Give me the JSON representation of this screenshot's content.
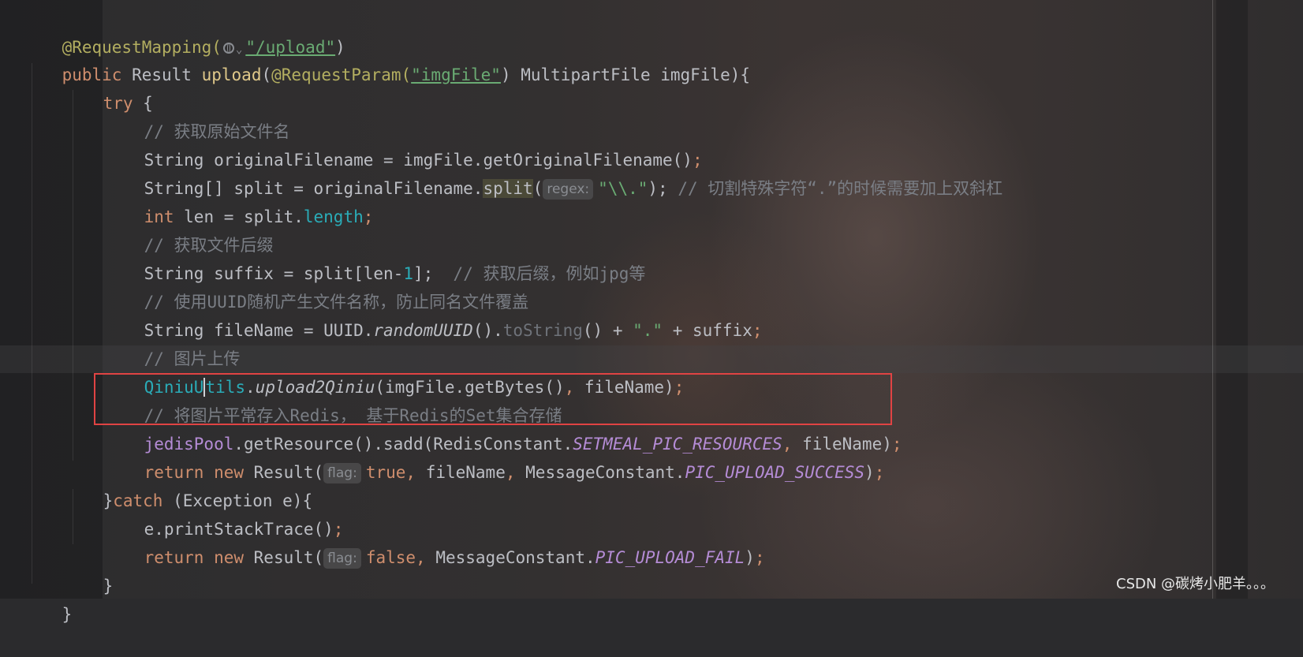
{
  "code": {
    "l1": {
      "ann": "@RequestMapping(",
      "str": "\"/upload\"",
      "end": ")"
    },
    "l2": {
      "kw": "public ",
      "t1": "Result ",
      "fn": "upload",
      "t2": "(",
      "ann": "@RequestParam(",
      "str": "\"imgFile\"",
      "t3": ") MultipartFile imgFile){"
    },
    "l3": {
      "kw": "try ",
      "t1": "{"
    },
    "l4": {
      "cmt": "// 获取原始文件名"
    },
    "l5": {
      "t1": "String originalFilename = imgFile.getOriginalFilename()",
      "semi": ";"
    },
    "l6": {
      "t1": "String[] split = originalFilename.",
      "split": "split",
      "t2": "(",
      "hint": "regex:",
      "str": "\"\\\\.\"",
      "t3": "); ",
      "cmt": "// 切割特殊字符“.”的时候需要加上双斜杠"
    },
    "l7": {
      "kw": "int ",
      "t1": "len = split.",
      "fld": "length",
      "semi": ";"
    },
    "l8": {
      "cmt": "// 获取文件后缀"
    },
    "l9": {
      "t1": "String suffix = split[len-",
      "num": "1",
      "t2": "];",
      "cmt": "  // 获取后缀，例如jpg等"
    },
    "l10": {
      "cmt": "// 使用UUID随机产生文件名称，防止同名文件覆盖"
    },
    "l11": {
      "t1": "String fileName = UUID.",
      "ital": "randomUUID",
      "t2": "().",
      "mth": "toString",
      "t3": "() + ",
      "str": "\".\"",
      "t4": " + suffix",
      "semi": ";"
    },
    "l12": {
      "cmt": "// 图片上传"
    },
    "l13": {
      "cls_a": "QiniuU",
      "cls_b": "tils",
      "t1": ".",
      "ital": "upload2Qiniu",
      "t2": "(imgFile.getBytes()",
      "comma": ", ",
      "t3": "fileName)",
      "semi": ";"
    },
    "l14": {
      "cmt": "// 将图片平常存入Redis， 基于Redis的Set集合存储"
    },
    "l15": {
      "fld": "jedisPool",
      "t1": ".getResource().sadd(RedisConstant.",
      "cst": "SETMEAL_PIC_RESOURCES",
      "comma": ", ",
      "t2": "fileName)",
      "semi": ";"
    },
    "l16": {
      "kw": "return new ",
      "t1": "Result(",
      "hint": "flag:",
      "kw2": "true",
      "comma": ", ",
      "t2": "fileName",
      "comma2": ", ",
      "t3": "MessageConstant.",
      "cst": "PIC_UPLOAD_SUCCESS",
      "t4": ")",
      "semi": ";"
    },
    "l17": {
      "t1": "}",
      "kw": "catch ",
      "t2": "(Exception e){"
    },
    "l18": {
      "t1": "e.printStackTrace()",
      "semi": ";"
    },
    "l19": {
      "kw": "return new ",
      "t1": "Result(",
      "hint": "flag:",
      "kw2": "false",
      "comma": ", ",
      "t3": "MessageConstant.",
      "cst": "PIC_UPLOAD_FAIL",
      "t4": ")",
      "semi": ";"
    },
    "l20": {
      "t1": "}"
    },
    "l21": {
      "t1": "}"
    }
  },
  "watermark": "CSDN @碳烤小肥羊。。。",
  "colors": {
    "keyword": "#cf8e6d",
    "annotation": "#b3ae60",
    "string": "#6aab73",
    "comment": "#7a7e85",
    "field": "#b58cd6",
    "highlight_box": "#e04343"
  }
}
